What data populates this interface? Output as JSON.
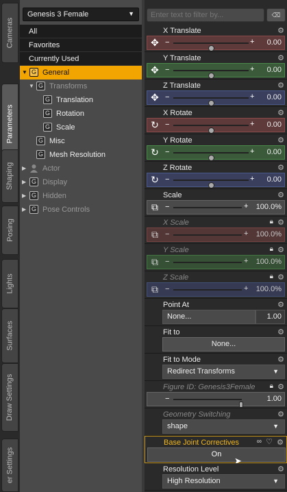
{
  "tabs": [
    {
      "label": "Cameras",
      "active": false
    },
    {
      "label": "Parameters",
      "active": true
    },
    {
      "label": "Shaping",
      "active": false
    },
    {
      "label": "Posing",
      "active": false
    },
    {
      "label": "Lights",
      "active": false
    },
    {
      "label": "Surfaces",
      "active": false
    },
    {
      "label": "Draw Settings",
      "active": false
    },
    {
      "label": "er Settings",
      "active": false
    }
  ],
  "node_select": {
    "value": "Genesis 3 Female"
  },
  "tree": {
    "all": "All",
    "favorites": "Favorites",
    "current": "Currently Used",
    "general": "General",
    "transforms": "Transforms",
    "translation": "Translation",
    "rotation": "Rotation",
    "scale": "Scale",
    "misc": "Misc",
    "mesh_resolution": "Mesh Resolution",
    "actor": "Actor",
    "display": "Display",
    "hidden": "Hidden",
    "pose_controls": "Pose Controls"
  },
  "filter": {
    "placeholder": "Enter text to filter by..."
  },
  "props": {
    "x_translate": {
      "label": "X Translate",
      "value": "0.00",
      "fraction": 0.5
    },
    "y_translate": {
      "label": "Y Translate",
      "value": "0.00",
      "fraction": 0.5
    },
    "z_translate": {
      "label": "Z Translate",
      "value": "0.00",
      "fraction": 0.5
    },
    "x_rotate": {
      "label": "X Rotate",
      "value": "0.00",
      "fraction": 0.5
    },
    "y_rotate": {
      "label": "Y Rotate",
      "value": "0.00",
      "fraction": 0.5
    },
    "z_rotate": {
      "label": "Z Rotate",
      "value": "0.00",
      "fraction": 0.5
    },
    "scale": {
      "label": "Scale",
      "value": "100.0%"
    },
    "x_scale": {
      "label": "X Scale",
      "value": "100.0%"
    },
    "y_scale": {
      "label": "Y Scale",
      "value": "100.0%"
    },
    "z_scale": {
      "label": "Z Scale",
      "value": "100.0%"
    },
    "point_at": {
      "label": "Point At",
      "value": "None...",
      "weight": "1.00"
    },
    "fit_to": {
      "label": "Fit to",
      "value": "None..."
    },
    "fit_to_mode": {
      "label": "Fit to Mode",
      "value": "Redirect Transforms"
    },
    "figure_id": {
      "label": "Figure ID: Genesis3Female",
      "value": "1.00"
    },
    "geometry_switching": {
      "label": "Geometry Switching",
      "value": "shape"
    },
    "base_joint": {
      "label": "Base Joint Correctives",
      "value": "On"
    },
    "resolution_level": {
      "label": "Resolution Level",
      "value": "High Resolution"
    }
  },
  "colors": {
    "accent": "#f2a500",
    "red": "#5e3a3a",
    "green": "#3a5a3a",
    "blue": "#3a3f5e"
  },
  "icons": {
    "move": "move-icon",
    "rotate": "rotate-icon",
    "scale": "scale-icon",
    "gear": "gear-icon",
    "lock": "lock-icon",
    "heart": "heart-icon",
    "link": "link-icon"
  }
}
